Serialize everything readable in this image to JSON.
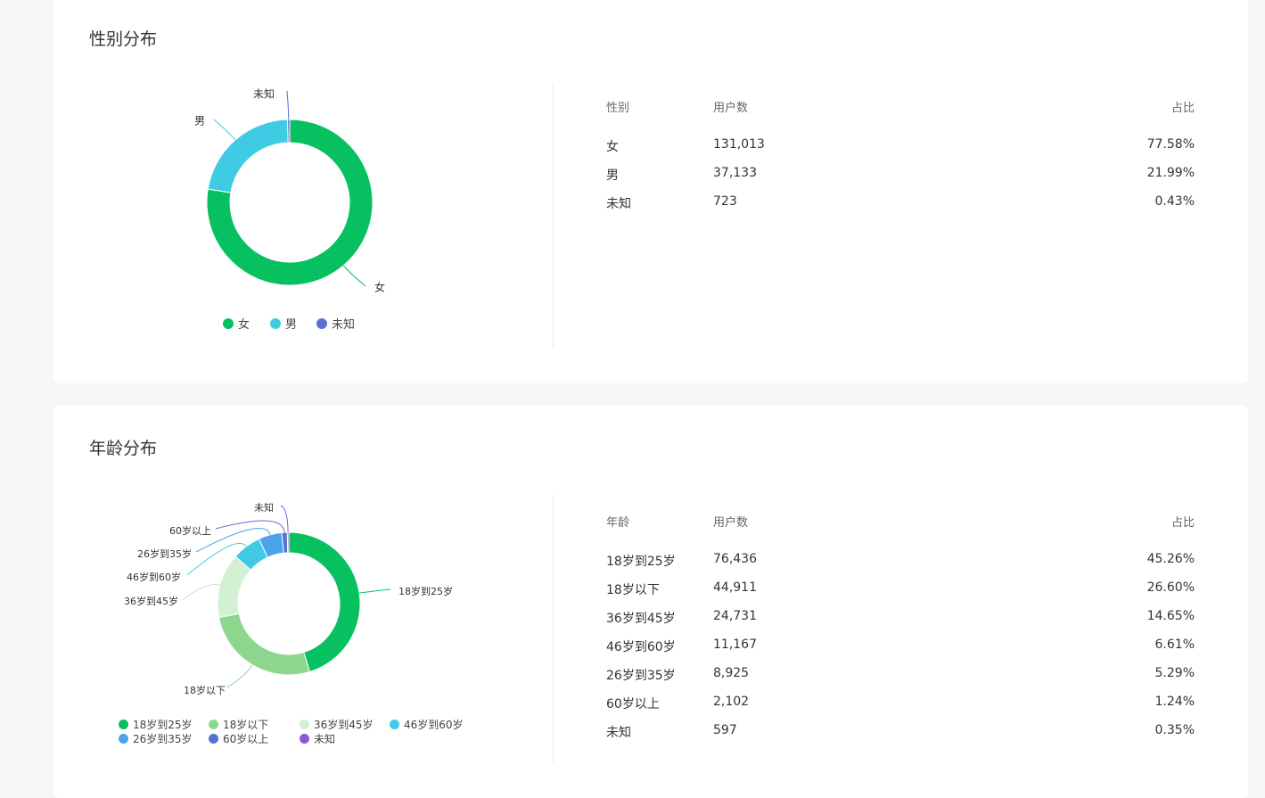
{
  "gender": {
    "title": "性别分布",
    "table": {
      "headers": [
        "性别",
        "用户数",
        "占比"
      ],
      "rows": [
        {
          "label": "女",
          "count": "131,013",
          "pct": "77.58%"
        },
        {
          "label": "男",
          "count": "37,133",
          "pct": "21.99%"
        },
        {
          "label": "未知",
          "count": "723",
          "pct": "0.43%"
        }
      ]
    }
  },
  "age": {
    "title": "年龄分布",
    "table": {
      "headers": [
        "年龄",
        "用户数",
        "占比"
      ],
      "rows": [
        {
          "label": "18岁到25岁",
          "count": "76,436",
          "pct": "45.26%"
        },
        {
          "label": "18岁以下",
          "count": "44,911",
          "pct": "26.60%"
        },
        {
          "label": "36岁到45岁",
          "count": "24,731",
          "pct": "14.65%"
        },
        {
          "label": "46岁到60岁",
          "count": "11,167",
          "pct": "6.61%"
        },
        {
          "label": "26岁到35岁",
          "count": "8,925",
          "pct": "5.29%"
        },
        {
          "label": "60岁以上",
          "count": "2,102",
          "pct": "1.24%"
        },
        {
          "label": "未知",
          "count": "597",
          "pct": "0.35%"
        }
      ]
    }
  },
  "chart_data": [
    {
      "type": "pie",
      "title": "性别分布",
      "legend_position": "bottom",
      "categories": [
        "女",
        "男",
        "未知"
      ],
      "values": [
        77.58,
        21.99,
        0.43
      ],
      "colors": [
        "#07c160",
        "#3fcbe4",
        "#5b6fd6"
      ]
    },
    {
      "type": "pie",
      "title": "年龄分布",
      "legend_position": "bottom",
      "categories": [
        "18岁到25岁",
        "18岁以下",
        "36岁到45岁",
        "46岁到60岁",
        "26岁到35岁",
        "60岁以上",
        "未知"
      ],
      "values": [
        45.26,
        26.6,
        14.65,
        6.61,
        5.29,
        1.24,
        0.35
      ],
      "colors": [
        "#07c160",
        "#8dd68d",
        "#d3f0d3",
        "#3fcbe4",
        "#4da3ea",
        "#5b6fd6",
        "#8a5bd6"
      ]
    }
  ]
}
